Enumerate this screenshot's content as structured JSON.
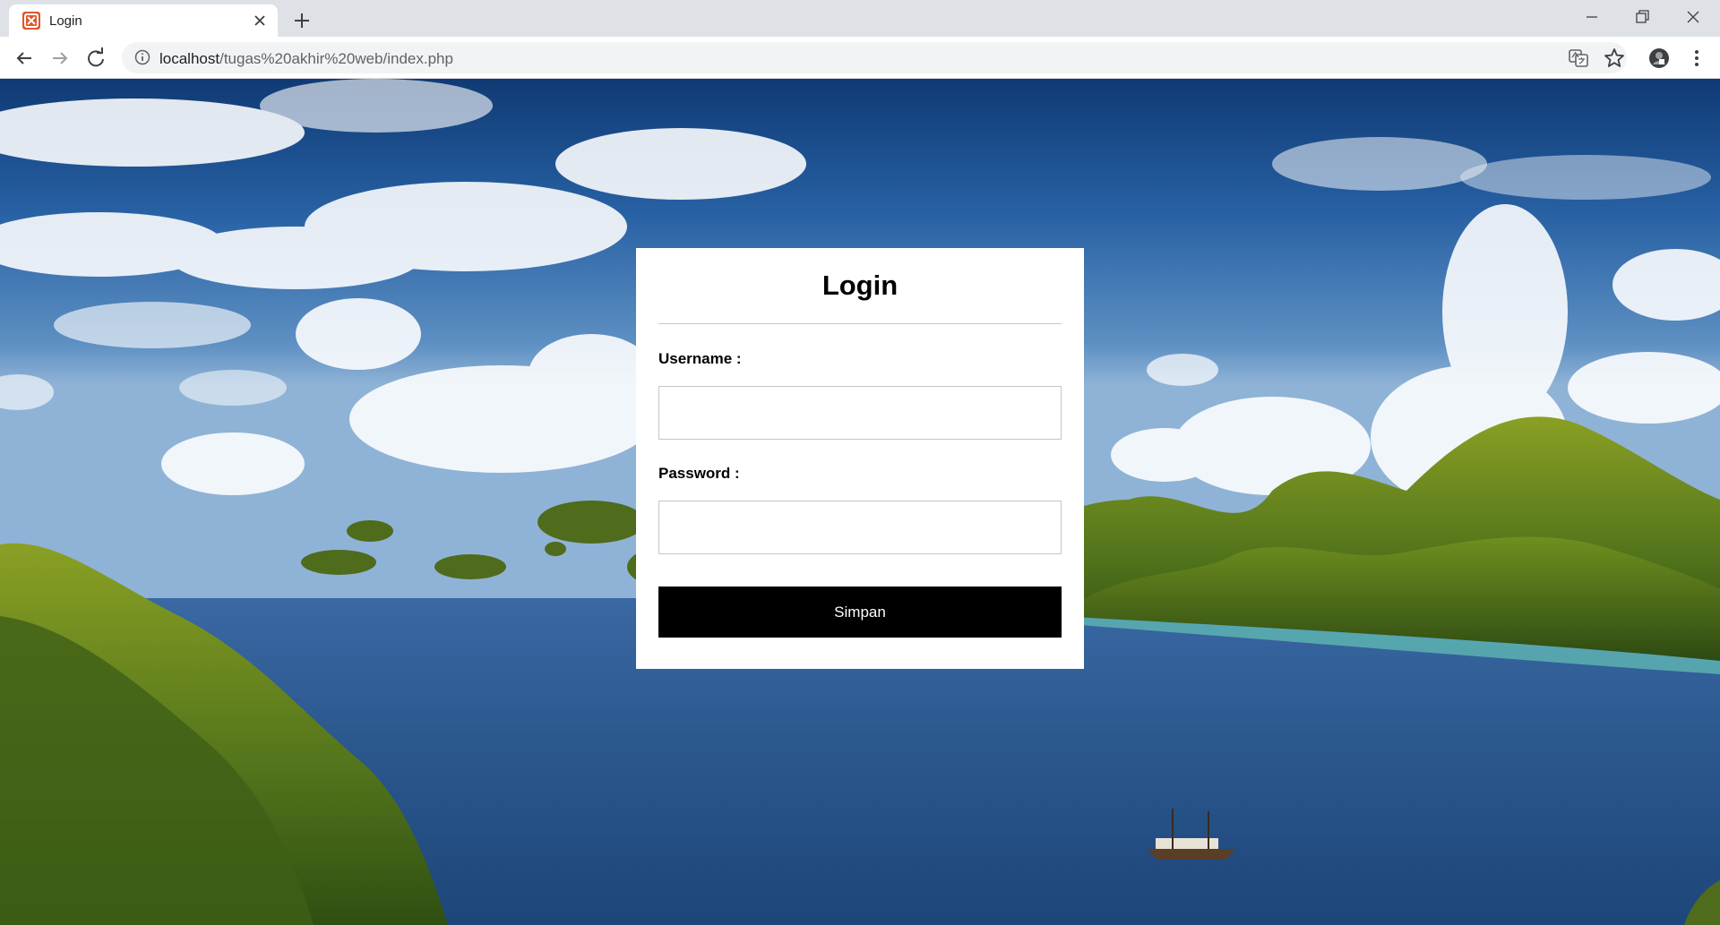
{
  "browser": {
    "tab": {
      "title": "Login",
      "favicon": "xampp-icon"
    },
    "url": {
      "host": "localhost",
      "path": "/tugas%20akhir%20web/index.php"
    }
  },
  "login": {
    "title": "Login",
    "username": {
      "label": "Username :",
      "value": "",
      "placeholder": ""
    },
    "password": {
      "label": "Password :",
      "value": "",
      "placeholder": ""
    },
    "submit_label": "Simpan"
  },
  "colors": {
    "favicon": "#e0572a",
    "button": "#000000",
    "card": "#ffffff"
  }
}
